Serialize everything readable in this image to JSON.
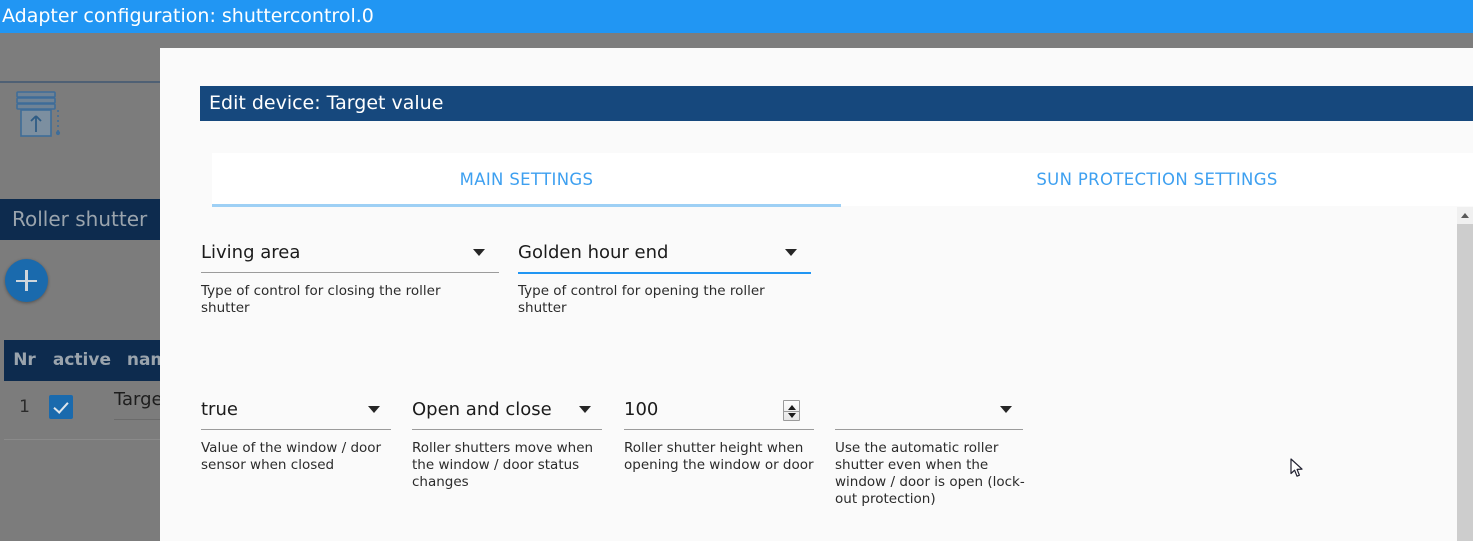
{
  "window": {
    "title": "Adapter configuration: shuttercontrol.0",
    "titlebar_color": "#2196f3"
  },
  "background": {
    "device_icon": "roller-shutter-icon",
    "section_title": "Roller shutter",
    "add_button_label": "+",
    "table": {
      "columns": [
        "Nr",
        "active",
        "name"
      ],
      "rows": [
        {
          "nr": "1",
          "active": true,
          "name": "Target"
        }
      ]
    }
  },
  "dialog": {
    "header": "Edit device: Target value",
    "header_color": "#16487d",
    "accent_color": "#2196f3",
    "tabs": [
      {
        "label": "MAIN SETTINGS",
        "active": true
      },
      {
        "label": "SUN PROTECTION SETTINGS",
        "active": false
      }
    ],
    "fields": [
      {
        "name": "type-of-control-closing",
        "control": "select",
        "value": "Living area",
        "helper": "Type of control for closing the roller shutter",
        "focused": false
      },
      {
        "name": "type-of-control-opening",
        "control": "select",
        "value": "Golden hour end",
        "helper": "Type of control for opening the roller shutter",
        "focused": true
      },
      {
        "name": "sensor-closed-value",
        "control": "select",
        "value": "true",
        "helper": "Value of the window / door sensor when closed",
        "focused": false
      },
      {
        "name": "shutter-move-on-status-change",
        "control": "select",
        "value": "Open and close",
        "helper": "Roller shutters move when the window / door status changes",
        "focused": false
      },
      {
        "name": "shutter-height-on-open",
        "control": "number",
        "value": "100",
        "helper": "Roller shutter height when opening the window or door",
        "focused": false
      },
      {
        "name": "lock-out-protection",
        "control": "select",
        "value": "",
        "helper": "Use the automatic roller shutter even when the window / door is open (lock-out protection)",
        "focused": false
      }
    ]
  },
  "scrollbar": {
    "up_arrow": "chevron-up-icon"
  }
}
